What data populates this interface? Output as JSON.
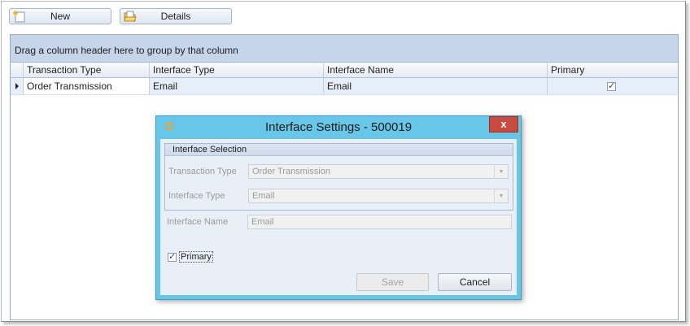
{
  "toolbar": {
    "new_label": "New",
    "details_label": "Details"
  },
  "grid": {
    "group_hint": "Drag a column header here to group by that column",
    "columns": [
      "Transaction Type",
      "Interface Type",
      "Interface Name",
      "Primary"
    ],
    "rows": [
      {
        "transaction_type": "Order Transmission",
        "interface_type": "Email",
        "interface_name": "Email",
        "primary": true
      }
    ]
  },
  "dialog": {
    "title": "Interface Settings - 500019",
    "close_glyph": "x",
    "group_title": "Interface Selection",
    "transaction_type_label": "Transaction Type",
    "transaction_type_value": "Order Transmission",
    "interface_type_label": "Interface Type",
    "interface_type_value": "Email",
    "interface_name_label": "Interface Name",
    "interface_name_value": "Email",
    "primary_label": "Primary",
    "primary_checked": true,
    "save_label": "Save",
    "cancel_label": "Cancel"
  },
  "colors": {
    "dialog_title_bar": "#68c6e8",
    "close_button": "#c94a3e",
    "grid_group_panel": "#c6d5ea"
  }
}
